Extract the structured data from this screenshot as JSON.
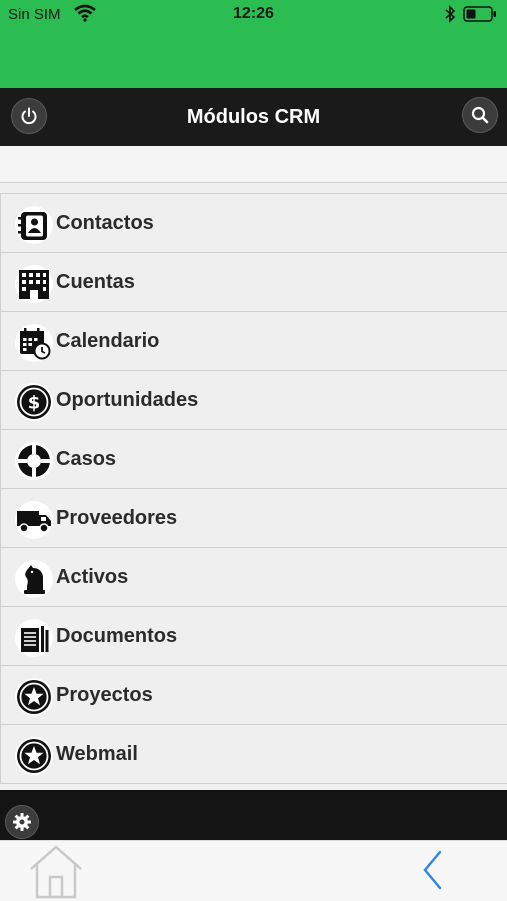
{
  "status_bar": {
    "carrier": "Sin SIM",
    "time": "12:26"
  },
  "header": {
    "title": "Módulos CRM"
  },
  "modules": [
    {
      "label": "Contactos",
      "icon": "contacts-book-icon"
    },
    {
      "label": "Cuentas",
      "icon": "building-icon"
    },
    {
      "label": "Calendario",
      "icon": "calendar-clock-icon"
    },
    {
      "label": "Oportunidades",
      "icon": "dollar-coin-icon"
    },
    {
      "label": "Casos",
      "icon": "lifebuoy-icon"
    },
    {
      "label": "Proveedores",
      "icon": "truck-icon"
    },
    {
      "label": "Activos",
      "icon": "chess-knight-icon"
    },
    {
      "label": "Documentos",
      "icon": "documents-icon"
    },
    {
      "label": "Proyectos",
      "icon": "star-badge-icon"
    },
    {
      "label": "Webmail",
      "icon": "star-badge-icon"
    }
  ],
  "colors": {
    "status_bar": "#2cbd52",
    "header": "#1a1a1a",
    "back_arrow": "#2b86e6"
  }
}
